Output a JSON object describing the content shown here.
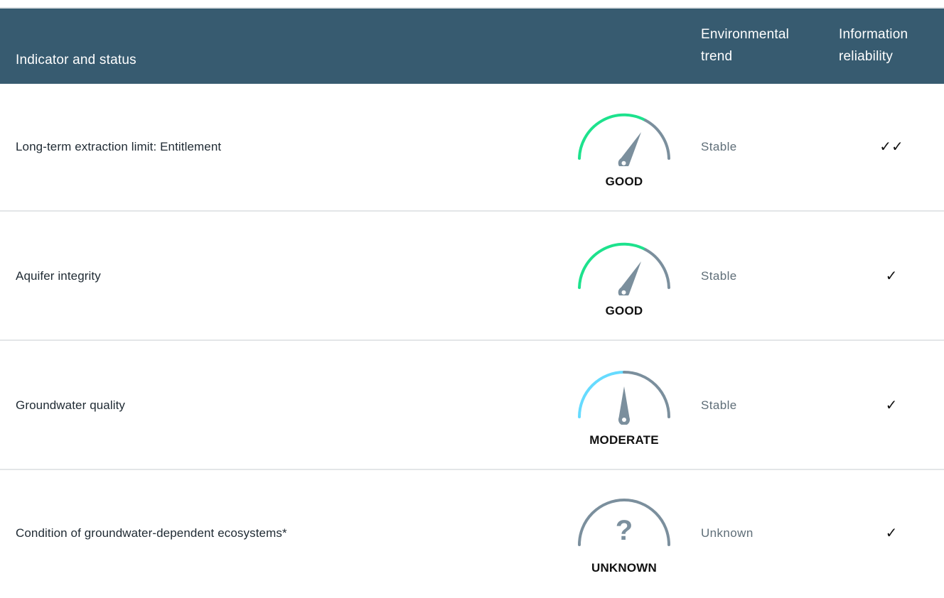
{
  "header": {
    "indicator": "Indicator and status",
    "trend": "Environmental trend",
    "reliability": "Information reliability"
  },
  "colors": {
    "header_bg": "#375b70",
    "good_arc": "#1de28d",
    "moderate_arc": "#66dbff",
    "neutral_arc": "#7b8f9d",
    "needle": "#7b8f9d"
  },
  "rows": [
    {
      "indicator": "Long-term extraction limit: Entitlement",
      "status": "GOOD",
      "status_icon": "gauge-good-icon",
      "trend": "Stable",
      "reliability": "✓✓"
    },
    {
      "indicator": "Aquifer integrity",
      "status": "GOOD",
      "status_icon": "gauge-good-icon",
      "trend": "Stable",
      "reliability": "✓"
    },
    {
      "indicator": "Groundwater quality",
      "status": "MODERATE",
      "status_icon": "gauge-moderate-icon",
      "trend": "Stable",
      "reliability": "✓"
    },
    {
      "indicator": "Condition of groundwater-dependent ecosystems*",
      "status": "UNKNOWN",
      "status_icon": "gauge-unknown-icon",
      "trend": "Unknown",
      "reliability": "✓"
    }
  ]
}
